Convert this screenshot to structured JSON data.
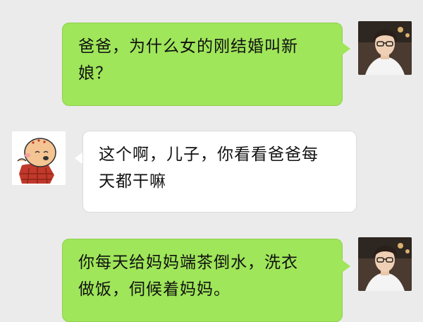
{
  "colors": {
    "background": "#ebebeb",
    "outgoing_bubble": "#9fe65a",
    "incoming_bubble": "#ffffff"
  },
  "messages": [
    {
      "sender": "self",
      "avatar_icon": "user-photo-avatar-icon",
      "lines": [
        "爸爸，为什么女的刚结婚叫新",
        "娘？"
      ]
    },
    {
      "sender": "other",
      "avatar_icon": "cartoon-monk-avatar-icon",
      "lines": [
        "这个啊，儿子，你看看爸爸每",
        "天都干嘛"
      ]
    },
    {
      "sender": "self",
      "avatar_icon": "user-photo-avatar-icon",
      "lines": [
        "你每天给妈妈端茶倒水，洗衣",
        "做饭，伺候着妈妈。"
      ]
    }
  ]
}
